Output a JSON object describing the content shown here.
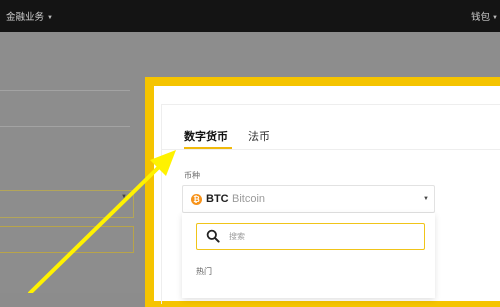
{
  "nav": {
    "left_label": "金融业务",
    "right_label": "钱包"
  },
  "modal": {
    "tabs": [
      {
        "label": "数字货币",
        "active": true
      },
      {
        "label": "法币",
        "active": false
      }
    ],
    "currency_label": "币种",
    "selected": {
      "icon": "bitcoin-icon",
      "symbol": "BTC",
      "name": "Bitcoin"
    },
    "search": {
      "placeholder": "搜索",
      "icon": "search-icon"
    },
    "popular_label": "热门"
  },
  "colors": {
    "highlight_frame": "#f5c400",
    "arrow": "#fff200",
    "tab_underline": "#f0b90b",
    "bitcoin": "#f7931a",
    "topbar": "#141414",
    "overlay": "#8d8d8d"
  }
}
